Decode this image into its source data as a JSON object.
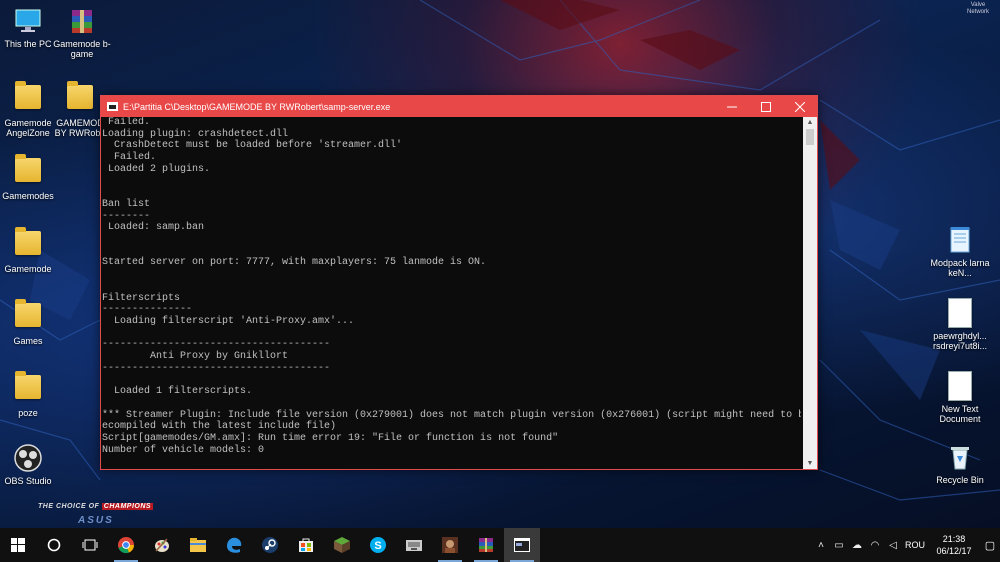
{
  "desktop": {
    "icons_left": [
      {
        "label": "This the PC",
        "icon": "this-pc-icon"
      },
      {
        "label": "Gamemode b-game",
        "icon": "winrar-archive-icon"
      },
      {
        "label": "Gamemode AngelZone",
        "icon": "folder-icon"
      },
      {
        "label": "GAMEMOD BY RWRobe",
        "icon": "folder-icon"
      },
      {
        "label": "Gamemodes",
        "icon": "folder-icon"
      },
      {
        "label": "Gamemode",
        "icon": "folder-icon"
      },
      {
        "label": "Games",
        "icon": "folder-icon"
      },
      {
        "label": "poze",
        "icon": "folder-icon"
      },
      {
        "label": "OBS Studio",
        "icon": "obs-icon"
      }
    ],
    "icons_right": [
      {
        "label": "Modpack larna keN...",
        "icon": "notepad-icon"
      },
      {
        "label": "paewrghdyl... rsdreyi7ut8i...",
        "icon": "document-icon"
      },
      {
        "label": "New Text Document",
        "icon": "document-icon"
      },
      {
        "label": "Recycle Bin",
        "icon": "recycle-bin-icon"
      }
    ],
    "wallpaper": {
      "slogan_prefix": "THE CHOICE OF",
      "slogan_highlight": "CHAMPIONS",
      "brand": "ASUS",
      "corner_mark": "Valve\nNetwork"
    }
  },
  "console_window": {
    "title": "E:\\Partitia C\\Desktop\\GAMEMODE BY RWRobert\\samp-server.exe",
    "minimize_icon": "minimize-icon",
    "maximize_icon": "maximize-icon",
    "close_icon": "close-icon",
    "lines": [
      " Failed.",
      "Loading plugin: crashdetect.dll",
      "  CrashDetect must be loaded before 'streamer.dll'",
      "  Failed.",
      " Loaded 2 plugins.",
      "",
      "",
      "Ban list",
      "--------",
      " Loaded: samp.ban",
      "",
      "",
      "Started server on port: 7777, with maxplayers: 75 lanmode is ON.",
      "",
      "",
      "Filterscripts",
      "---------------",
      "  Loading filterscript 'Anti-Proxy.amx'...",
      "",
      "--------------------------------------",
      "        Anti Proxy by Gnikllort",
      "--------------------------------------",
      "",
      "  Loaded 1 filterscripts.",
      "",
      "*** Streamer Plugin: Include file version (0x279001) does not match plugin version (0x276001) (script might need to be r",
      "ecompiled with the latest include file)",
      "Script[gamemodes/GM.amx]: Run time error 19: \"File or function is not found\"",
      "Number of vehicle models: 0"
    ],
    "text_color": "#c0c0c0",
    "title_bar_color": "#e84848"
  },
  "taskbar": {
    "items": [
      {
        "name": "start-button",
        "icon": "windows-logo-icon",
        "active": false,
        "running": false
      },
      {
        "name": "cortana-button",
        "icon": "cortana-circle-icon",
        "active": false,
        "running": false
      },
      {
        "name": "task-view-button",
        "icon": "task-view-icon",
        "active": false,
        "running": false
      },
      {
        "name": "chrome-taskbar-button",
        "icon": "chrome-icon",
        "active": false,
        "running": true
      },
      {
        "name": "paint-taskbar-button",
        "icon": "paint-icon",
        "active": false,
        "running": false
      },
      {
        "name": "explorer-taskbar-button",
        "icon": "file-explorer-icon",
        "active": false,
        "running": false
      },
      {
        "name": "edge-taskbar-button",
        "icon": "edge-icon",
        "active": false,
        "running": false
      },
      {
        "name": "steam-taskbar-button",
        "icon": "steam-icon",
        "active": false,
        "running": false
      },
      {
        "name": "store-taskbar-button",
        "icon": "store-icon",
        "active": false,
        "running": false
      },
      {
        "name": "minecraft-taskbar-button",
        "icon": "minecraft-icon",
        "active": false,
        "running": false
      },
      {
        "name": "skype-taskbar-button",
        "icon": "skype-icon",
        "active": false,
        "running": false
      },
      {
        "name": "samp-taskbar-button",
        "icon": "samp-icon",
        "active": false,
        "running": false
      },
      {
        "name": "game-taskbar-button",
        "icon": "game-icon",
        "active": false,
        "running": true
      },
      {
        "name": "winrar-taskbar-button",
        "icon": "winrar-icon",
        "active": false,
        "running": true
      },
      {
        "name": "console-taskbar-button",
        "icon": "console-window-icon",
        "active": true,
        "running": true
      }
    ],
    "tray": {
      "chevron": "chevron-up-icon",
      "icons": [
        "battery-icon",
        "cloud-icon",
        "network-icon",
        "volume-icon"
      ],
      "language": "ROU",
      "time": "21:38",
      "date": "06/12/17",
      "notification_icon": "notification-icon"
    }
  }
}
